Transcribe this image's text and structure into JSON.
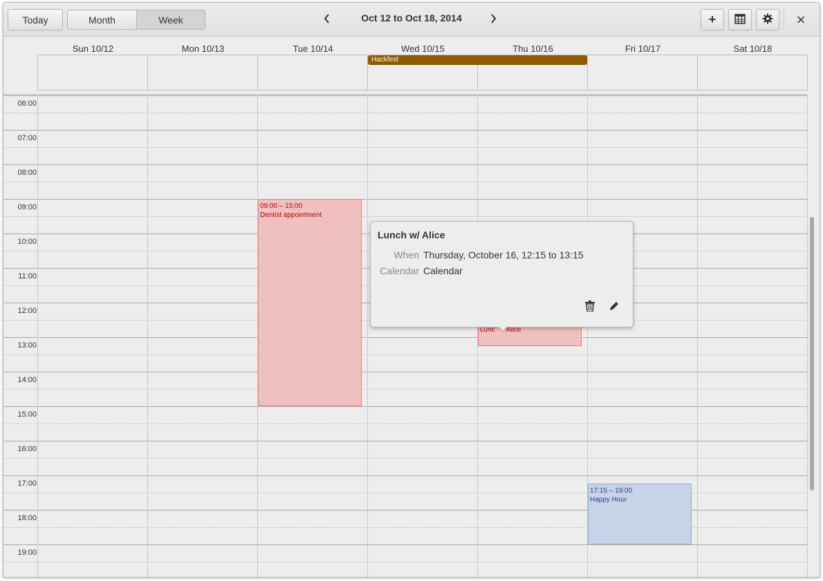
{
  "header": {
    "today_label": "Today",
    "views": [
      {
        "label": "Month"
      },
      {
        "label": "Week"
      }
    ],
    "selected_view": "Week",
    "title": "Oct 12 to Oct 18, 2014",
    "prev_icon": "chevron-left-icon",
    "next_icon": "chevron-right-icon",
    "add_icon": "plus-icon",
    "calendar_icon": "calendar-icon",
    "settings_icon": "gear-icon",
    "close_icon": "close-icon",
    "close_glyph": "×",
    "add_glyph": "+"
  },
  "days": [
    {
      "label": "Sun 10/12"
    },
    {
      "label": "Mon 10/13"
    },
    {
      "label": "Tue 10/14"
    },
    {
      "label": "Wed 10/15"
    },
    {
      "label": "Thu 10/16"
    },
    {
      "label": "Fri 10/17"
    },
    {
      "label": "Sat 10/18"
    }
  ],
  "all_day_events": [
    {
      "title": "Hackfest",
      "color": "#8e5a00"
    }
  ],
  "hours": [
    "06:00",
    "07:00",
    "08:00",
    "09:00",
    "10:00",
    "11:00",
    "12:00",
    "13:00",
    "14:00",
    "15:00",
    "16:00",
    "17:00",
    "18:00",
    "19:00"
  ],
  "events": [
    {
      "time": "09:00 – 15:00",
      "title": "Dentist appointment",
      "color": "#f0c0c0"
    },
    {
      "time": "12:15 – 13:15",
      "title": "Lunch w/ Alice",
      "visible_text": "Lunc    / Alice",
      "color": "#f0c0c0"
    },
    {
      "time": "17:15 – 19:00",
      "title": "Happy Hour",
      "color": "#c8d3e8"
    }
  ],
  "popover": {
    "title": "Lunch w/ Alice",
    "when_label": "When",
    "when_value": "Thursday, October 16, 12:15 to 13:15",
    "calendar_label": "Calendar",
    "calendar_value": "Calendar",
    "delete_icon": "trash-icon",
    "edit_icon": "pencil-icon"
  }
}
